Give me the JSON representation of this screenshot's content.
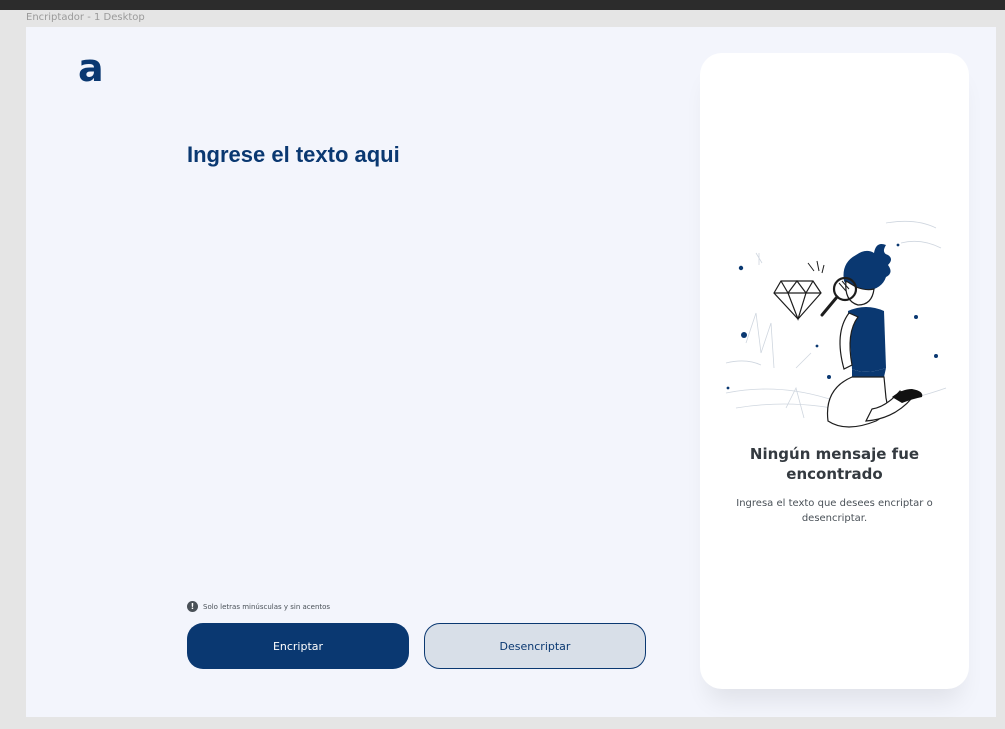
{
  "frame": {
    "label": "Encriptador - 1 Desktop"
  },
  "header": {
    "logo_text": "a"
  },
  "input": {
    "placeholder": "Ingrese el texto aqui",
    "value": ""
  },
  "hint": {
    "icon": "exclamation-circle-icon",
    "text": "Solo letras minúsculas y sin acentos"
  },
  "buttons": {
    "encrypt_label": "Encriptar",
    "decrypt_label": "Desencriptar"
  },
  "result": {
    "illustration": "person-with-magnifying-glass-and-diamond",
    "title": "Ningún mensaje fue encontrado",
    "description": "Ingresa el texto que desees encriptar o desencriptar."
  },
  "colors": {
    "brand": "#0a3871",
    "background": "#f3f5fc",
    "panel": "#ffffff",
    "secondary_button": "#d8dfe8",
    "text_dark": "#343a40",
    "text_muted": "#495057"
  }
}
